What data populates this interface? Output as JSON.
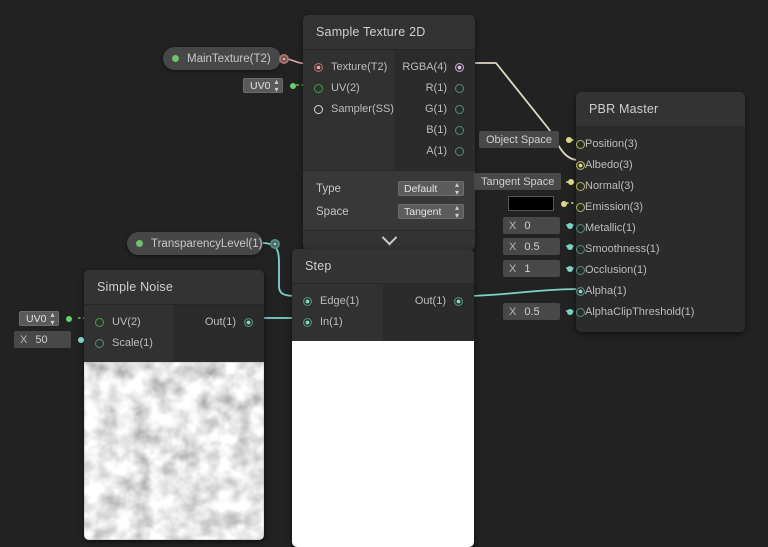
{
  "app": {
    "background_color": "#222222"
  },
  "properties": [
    {
      "name": "main-texture",
      "label": "MainTexture(T2)",
      "type": "texture"
    },
    {
      "name": "transparency-level",
      "label": "TransparencyLevel(1)",
      "type": "vector1"
    }
  ],
  "nodes": {
    "sample_texture": {
      "title": "Sample Texture 2D",
      "inputs": [
        {
          "label": "Texture(T2)",
          "color": "c-tex",
          "filled": true
        },
        {
          "label": "UV(2)",
          "color": "c-uv",
          "filled": false
        },
        {
          "label": "Sampler(SS)",
          "color": "c-ss",
          "filled": false
        }
      ],
      "outputs": [
        {
          "label": "RGBA(4)",
          "color": "c-rgba",
          "filled": true
        },
        {
          "label": "R(1)",
          "color": "c-vec",
          "filled": false
        },
        {
          "label": "G(1)",
          "color": "c-vec",
          "filled": false
        },
        {
          "label": "B(1)",
          "color": "c-vec",
          "filled": false
        },
        {
          "label": "A(1)",
          "color": "c-vec",
          "filled": false
        }
      ],
      "params": [
        {
          "label": "Type",
          "value": "Default"
        },
        {
          "label": "Space",
          "value": "Tangent"
        }
      ],
      "uv_field": {
        "value": "UV0"
      }
    },
    "pbr_master": {
      "title": "PBR Master",
      "inputs": [
        {
          "label": "Position(3)",
          "color": "c-yel",
          "filled": false,
          "field": {
            "kind": "space",
            "value": "Object Space",
            "dot": "fd-yel"
          }
        },
        {
          "label": "Albedo(3)",
          "color": "c-yel",
          "filled": true,
          "field": null
        },
        {
          "label": "Normal(3)",
          "color": "c-yel",
          "filled": false,
          "field": {
            "kind": "space",
            "value": "Tangent Space",
            "dot": "fd-yel"
          }
        },
        {
          "label": "Emission(3)",
          "color": "c-yel",
          "filled": false,
          "field": {
            "kind": "color",
            "value": "#000000",
            "dot": "fd-yel"
          }
        },
        {
          "label": "Metallic(1)",
          "color": "c-vec",
          "filled": false,
          "field": {
            "kind": "scalar",
            "axis": "X",
            "value": "0",
            "dot": "fd-teal"
          }
        },
        {
          "label": "Smoothness(1)",
          "color": "c-vec",
          "filled": false,
          "field": {
            "kind": "scalar",
            "axis": "X",
            "value": "0.5",
            "dot": "fd-teal"
          }
        },
        {
          "label": "Occlusion(1)",
          "color": "c-vec",
          "filled": false,
          "field": {
            "kind": "scalar",
            "axis": "X",
            "value": "1",
            "dot": "fd-teal"
          }
        },
        {
          "label": "Alpha(1)",
          "color": "c-vec",
          "filled": true,
          "field": null
        },
        {
          "label": "AlphaClipThreshold(1)",
          "color": "c-vec",
          "filled": false,
          "field": {
            "kind": "scalar",
            "axis": "X",
            "value": "0.5",
            "dot": "fd-teal"
          }
        }
      ]
    },
    "step": {
      "title": "Step",
      "inputs": [
        {
          "label": "Edge(1)",
          "color": "c-vec",
          "filled": true
        },
        {
          "label": "In(1)",
          "color": "c-vec",
          "filled": true
        }
      ],
      "outputs": [
        {
          "label": "Out(1)",
          "color": "c-vec",
          "filled": true
        }
      ],
      "preview": "solid-white"
    },
    "simple_noise": {
      "title": "Simple Noise",
      "inputs": [
        {
          "label": "UV(2)",
          "color": "c-uv",
          "filled": false,
          "field": {
            "kind": "uv",
            "value": "UV0",
            "dot": "fd-green"
          }
        },
        {
          "label": "Scale(1)",
          "color": "c-vec",
          "filled": false,
          "field": {
            "kind": "scalar",
            "axis": "X",
            "value": "50",
            "dot": "fd-teal"
          }
        }
      ],
      "outputs": [
        {
          "label": "Out(1)",
          "color": "c-vec",
          "filled": true
        }
      ],
      "preview": "grayscale-noise"
    }
  },
  "wire_colors": {
    "texture": "#e0a8b0",
    "uv": "#5bc45b",
    "rgba_to_albedo": "#ded6c0",
    "vector1": "#7fd4cc"
  }
}
